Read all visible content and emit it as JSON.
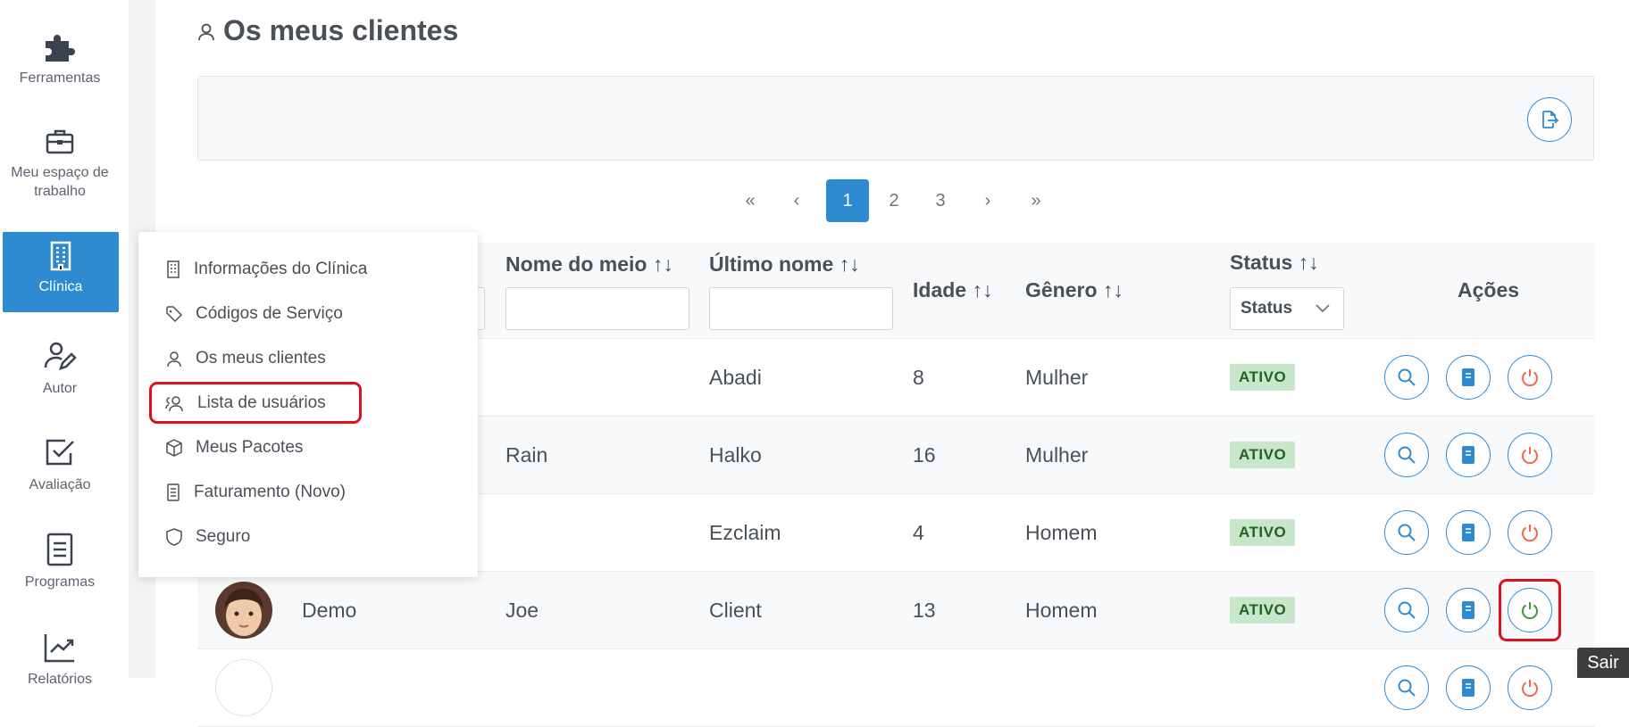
{
  "sidebar": {
    "items": [
      {
        "label": "Ferramentas",
        "icon": "puzzle-icon"
      },
      {
        "label": "Meu espaço de trabalho",
        "icon": "briefcase-icon"
      },
      {
        "label": "Clínica",
        "icon": "building-icon"
      },
      {
        "label": "Autor",
        "icon": "user-edit-icon"
      },
      {
        "label": "Avaliação",
        "icon": "check-square-icon"
      },
      {
        "label": "Programas",
        "icon": "file-lines-icon"
      },
      {
        "label": "Relatórios",
        "icon": "chart-line-icon"
      }
    ],
    "active": "Clínica"
  },
  "page": {
    "title": "Os meus clientes"
  },
  "pagination": {
    "first": "«",
    "prev": "‹",
    "pages": [
      "1",
      "2",
      "3"
    ],
    "current": "1",
    "next": "›",
    "last": "»"
  },
  "table": {
    "headers": {
      "middle_name": "Nome do meio ↑↓",
      "last_name": "Último nome ↑↓",
      "age": "Idade ↑↓",
      "gender": "Gênero ↑↓",
      "status": "Status ↑↓",
      "actions": "Ações"
    },
    "status_filter": "Status",
    "rows": [
      {
        "first_name": "",
        "middle_name": "",
        "last_name": "Abadi",
        "age": "8",
        "gender": "Mulher",
        "status": "ATIVO"
      },
      {
        "first_name": "",
        "middle_name": "Rain",
        "last_name": "Halko",
        "age": "16",
        "gender": "Mulher",
        "status": "ATIVO"
      },
      {
        "first_name": "",
        "middle_name": "",
        "last_name": "Ezclaim",
        "age": "4",
        "gender": "Homem",
        "status": "ATIVO"
      },
      {
        "first_name": "Demo",
        "middle_name": "Joe",
        "last_name": "Client",
        "age": "13",
        "gender": "Homem",
        "status": "ATIVO"
      }
    ]
  },
  "clinic_menu": {
    "items": [
      {
        "label": "Informações do Clínica",
        "icon": "building-icon"
      },
      {
        "label": "Códigos de Serviço",
        "icon": "tags-icon"
      },
      {
        "label": "Os meus clientes",
        "icon": "user-icon"
      },
      {
        "label": "Lista de usuários",
        "icon": "users-icon"
      },
      {
        "label": "Meus Pacotes",
        "icon": "box-icon"
      },
      {
        "label": "Faturamento (Novo)",
        "icon": "receipt-icon"
      },
      {
        "label": "Seguro",
        "icon": "shield-icon"
      }
    ]
  },
  "tooltip": "Sair",
  "colors": {
    "primary": "#2e8bd2",
    "danger": "#ef6c4a",
    "success": "#3a9c3e",
    "badge_bg": "#c8e6c9",
    "badge_text": "#256029",
    "highlight": "#e0101c"
  }
}
